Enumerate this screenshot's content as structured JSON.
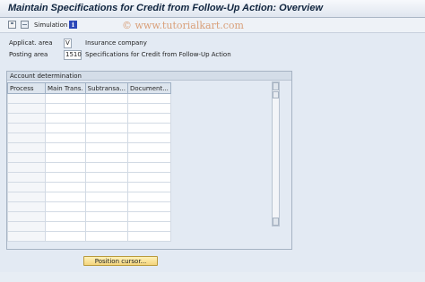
{
  "title": "Maintain Specifications for Credit from Follow-Up Action: Overview",
  "toolbar": {
    "simulation_label": "Simulation",
    "info_glyph": "i"
  },
  "watermark": "© www.tutorialkart.com",
  "fields": {
    "applicat_area": {
      "label": "Applicat. area",
      "value": "V",
      "description": "Insurance company"
    },
    "posting_area": {
      "label": "Posting area",
      "value": "1510",
      "description": "Specifications for Credit from Follow-Up Action"
    }
  },
  "group": {
    "title": "Account determination"
  },
  "table": {
    "columns": [
      "Process",
      "Main Trans.",
      "Subtransa...",
      "Document..."
    ],
    "empty_rows": 15
  },
  "buttons": {
    "position_cursor": "Position cursor..."
  }
}
